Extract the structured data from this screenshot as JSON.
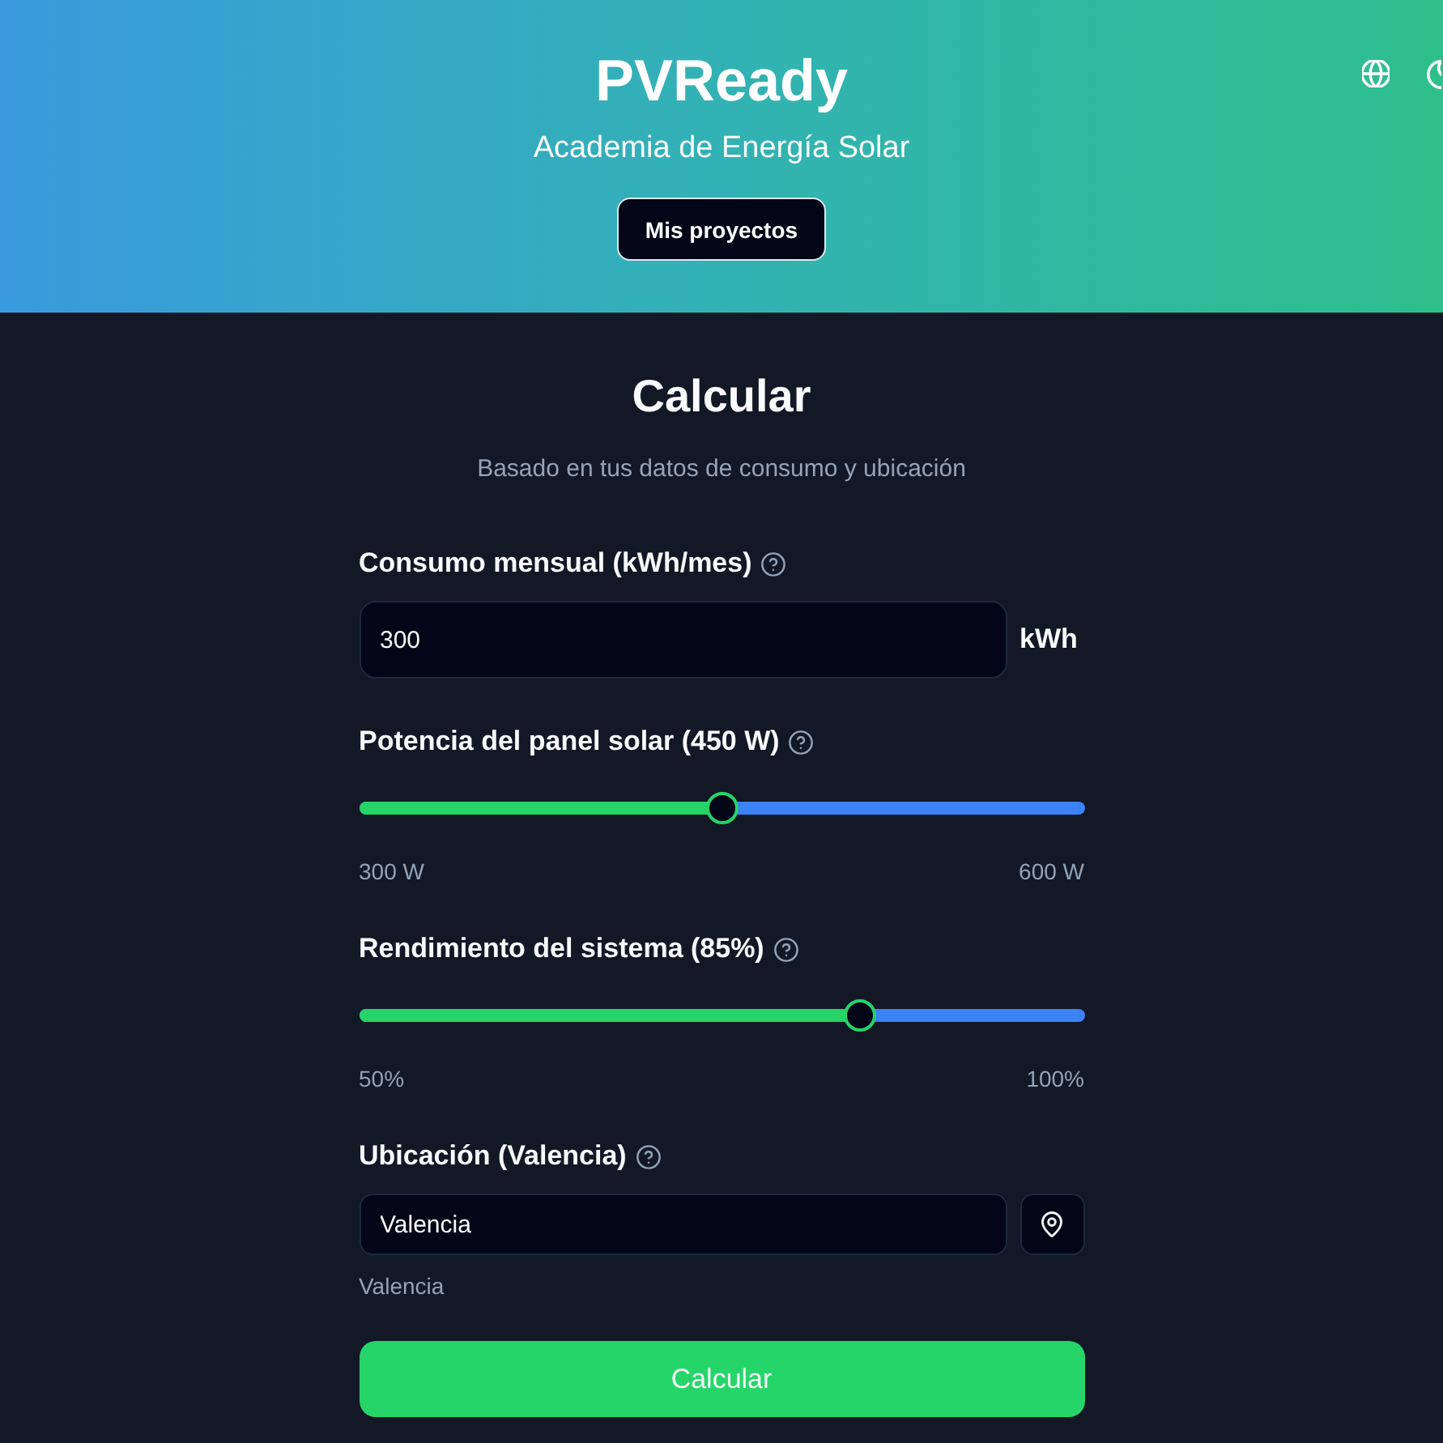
{
  "header": {
    "title": "PVReady",
    "subtitle": "Academia de Energía Solar",
    "button": "Mis proyectos"
  },
  "calculator": {
    "title": "Calcular",
    "subtitle": "Basado en tus datos de consumo y ubicación",
    "fields": [
      {
        "kind": "number",
        "label": "Consumo mensual (kWh/mes)",
        "value": "300",
        "unit": "kWh"
      },
      {
        "kind": "slider",
        "label": "Potencia del panel solar (450 W)",
        "level": 0.5,
        "min_label": "300 W",
        "max_label": "600 W"
      },
      {
        "kind": "slider",
        "label": "Rendimiento del sistema (85%)",
        "level": 0.7,
        "min_label": "50%",
        "max_label": "100%"
      },
      {
        "kind": "location",
        "label": "Ubicación (Valencia)",
        "value": "Valencia",
        "hint": "Valencia"
      }
    ],
    "submit": "Calcular"
  }
}
